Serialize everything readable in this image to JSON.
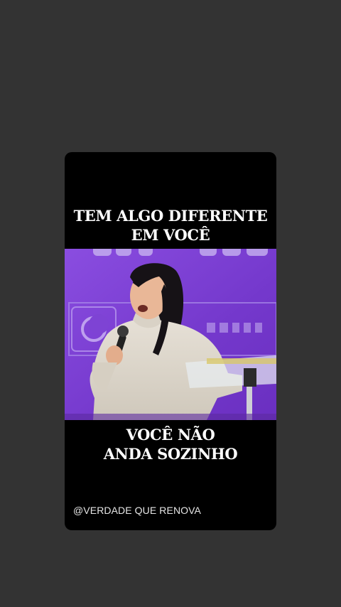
{
  "post": {
    "caption_top": [
      "TEM ALGO DIFERENTE",
      "EM VOCÊ"
    ],
    "caption_bottom": [
      "VOCÊ NÃO",
      "ANDA SOZINHO"
    ],
    "handle": "@VERDADE QUE RENOVA"
  },
  "colors": {
    "page_background": "#333333",
    "card_background": "#000000",
    "caption_text": "#ffffff",
    "stage_purple": "#7c3fd1"
  }
}
